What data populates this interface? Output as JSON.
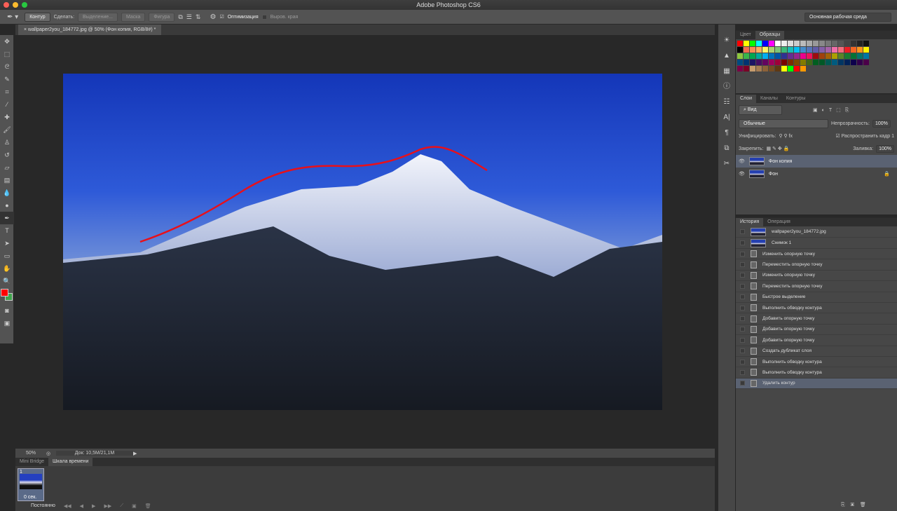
{
  "app_title": "Adobe Photoshop CS6",
  "options": {
    "mode": "Контур",
    "make_label": "Сделать:",
    "selection": "Выделение...",
    "mask": "Маска",
    "shape": "Фигура",
    "optimize_label": "Оптимизация",
    "align_edges": "Выров. края",
    "workspace": "Основная рабочая среда"
  },
  "document_tab": "wallpaper2you_184772.jpg @ 50% (Фон копия, RGB/8#) *",
  "status": {
    "zoom": "50%",
    "doc": "Док: 10,5M/21,1M"
  },
  "timeline": {
    "tabs": [
      "Mini Bridge",
      "Шкала времени"
    ],
    "frame_number": "1",
    "frame_time": "0 сек.",
    "loop": "Постоянно"
  },
  "swatches_panel": {
    "tabs": [
      "Цвет",
      "Образцы"
    ],
    "colors": [
      "#ff0000",
      "#ffff00",
      "#00ff00",
      "#00ffff",
      "#0000ff",
      "#ff00ff",
      "#ffffff",
      "#eeeeee",
      "#dddddd",
      "#cccccc",
      "#bbbbbb",
      "#aaaaaa",
      "#999999",
      "#888888",
      "#777777",
      "#666666",
      "#555555",
      "#444444",
      "#333333",
      "#222222",
      "#111111",
      "#000000",
      "#f26c4f",
      "#f68e55",
      "#fbaf5c",
      "#fff467",
      "#acd372",
      "#7cc576",
      "#3bb878",
      "#1abbb4",
      "#00bff3",
      "#438cca",
      "#5574b9",
      "#605ca8",
      "#855fa8",
      "#a763a8",
      "#f06ea9",
      "#f26d7d",
      "#ed1c24",
      "#f26522",
      "#f7941d",
      "#fff200",
      "#8dc73f",
      "#39b54a",
      "#00a651",
      "#00a99d",
      "#00aeef",
      "#0072bc",
      "#0054a6",
      "#2e3192",
      "#662d91",
      "#92278f",
      "#ec008c",
      "#ed145b",
      "#9e0b0f",
      "#a0410d",
      "#a36209",
      "#aba000",
      "#598527",
      "#1a7b30",
      "#007236",
      "#00746b",
      "#0076a3",
      "#004b80",
      "#003471",
      "#1b1464",
      "#440e62",
      "#630460",
      "#9e005d",
      "#9e0039",
      "#790000",
      "#7b2e00",
      "#7d4900",
      "#827b00",
      "#406618",
      "#005e20",
      "#005826",
      "#005952",
      "#005b7f",
      "#003663",
      "#002157",
      "#0d004c",
      "#32004b",
      "#4b0049",
      "#7b0046",
      "#7a0026",
      "#c69c6d",
      "#a67c52",
      "#8c6239",
      "#754c24",
      "#603913",
      "#ffff00",
      "#00ff00",
      "#ff0000",
      "#ff9900"
    ]
  },
  "layers_panel": {
    "tabs": [
      "Слои",
      "Каналы",
      "Контуры"
    ],
    "filter": "Вид",
    "blend_mode": "Обычные",
    "opacity_label": "Непрозрачность:",
    "opacity": "100%",
    "unify_label": "Унифицировать:",
    "propagate_label": "Распространить кадр 1",
    "lock_label": "Закрепить:",
    "fill_label": "Заливка:",
    "fill": "100%",
    "layers": [
      {
        "name": "Фон копия",
        "selected": true
      },
      {
        "name": "Фон",
        "selected": false
      }
    ]
  },
  "history_panel": {
    "tabs": [
      "История",
      "Операция"
    ],
    "snapshots": [
      "wallpaper2you_184772.jpg",
      "Снимок 1"
    ],
    "items": [
      "Изменить опорную точку",
      "Переместить опорную точку",
      "Изменить опорную точку",
      "Переместить опорную точку",
      "Быстрое выделение",
      "Выполнить обводку контура",
      "Добавить опорную точку",
      "Добавить опорную точку",
      "Добавить опорную точку",
      "Создать дубликат слоя",
      "Выполнить обводку контура",
      "Выполнить обводку контура",
      "Удалить контур"
    ]
  },
  "colors": {
    "foreground": "#ff0000",
    "background": "#3fa34d",
    "stroke": "#e8101a"
  }
}
